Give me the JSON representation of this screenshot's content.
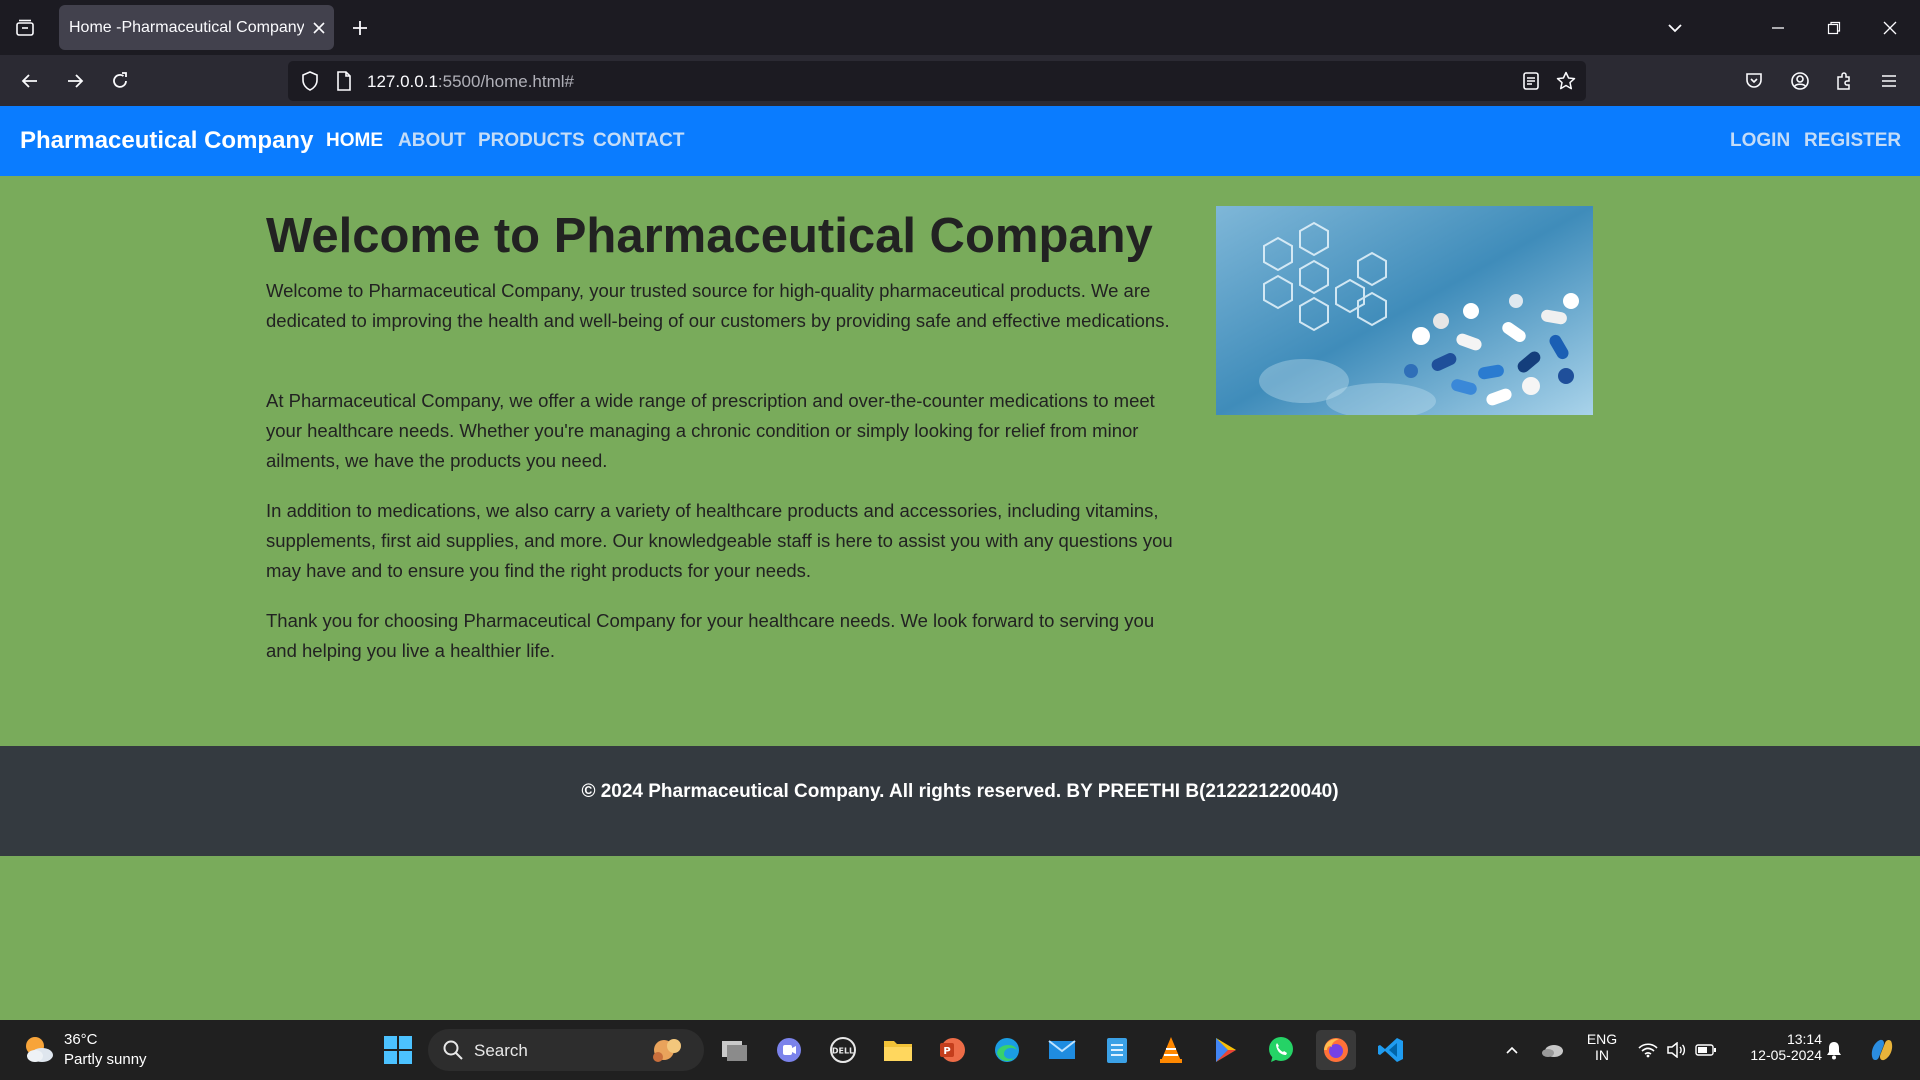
{
  "browser": {
    "tab_title": "Home -Pharmaceutical Company",
    "url_host": "127.0.0.1",
    "url_rest": ":5500/home.html#"
  },
  "site": {
    "brand": "Pharmaceutical Company",
    "nav": [
      "HOME",
      "ABOUT",
      "PRODUCTS",
      "CONTACT"
    ],
    "auth": [
      "LOGIN",
      "REGISTER"
    ],
    "title": "Welcome to Pharmaceutical Company",
    "paragraphs": [
      "Welcome to Pharmaceutical Company, your trusted source for high-quality pharmaceutical products. We are dedicated to improving the health and well-being of our customers by providing safe and effective medications.",
      "At Pharmaceutical Company, we offer a wide range of prescription and over-the-counter medications to meet your healthcare needs. Whether you're managing a chronic condition or simply looking for relief from minor ailments, we have the products you need.",
      "In addition to medications, we also carry a variety of healthcare products and accessories, including vitamins, supplements, first aid supplies, and more. Our knowledgeable staff is here to assist you with any questions you may have and to ensure you find the right products for your needs.",
      "Thank you for choosing Pharmaceutical Company for your healthcare needs. We look forward to serving you and helping you live a healthier life."
    ],
    "footer": "© 2024 Pharmaceutical Company. All rights reserved. BY PREETHI B(212221220040)"
  },
  "taskbar": {
    "temperature": "36°C",
    "weather": "Partly sunny",
    "search_placeholder": "Search",
    "lang_top": "ENG",
    "lang_bottom": "IN",
    "time": "13:14",
    "date": "12-05-2024"
  },
  "colors": {
    "header": "#0a7cff",
    "page_bg": "#79ab5b",
    "footer": "#343a40"
  }
}
